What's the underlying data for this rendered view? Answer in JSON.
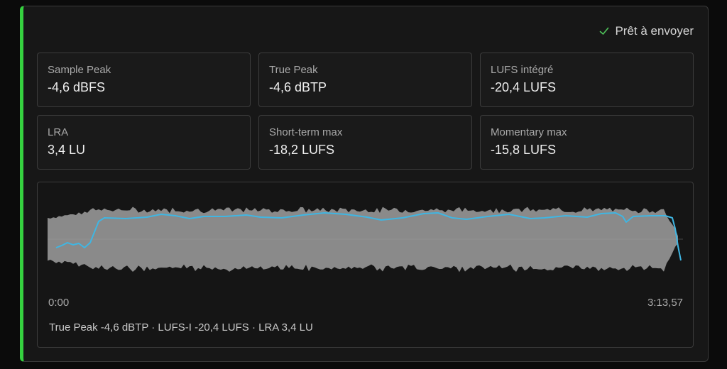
{
  "status": {
    "text": "Prêt à envoyer",
    "icon": "check-icon",
    "color": "#35d13f"
  },
  "metrics": [
    {
      "label": "Sample Peak",
      "value": "-4,6 dBFS"
    },
    {
      "label": "True Peak",
      "value": "-4,6 dBTP"
    },
    {
      "label": "LUFS intégré",
      "value": "-20,4 LUFS"
    },
    {
      "label": "LRA",
      "value": "3,4 LU"
    },
    {
      "label": "Short-term max",
      "value": "-18,2 LUFS"
    },
    {
      "label": "Momentary max",
      "value": "-15,8 LUFS"
    }
  ],
  "waveform": {
    "start_time": "0:00",
    "end_time": "3:13,57",
    "summary": "True Peak -4,6 dBTP · LUFS-I -20,4 LUFS · LRA 3,4 LU",
    "colors": {
      "accent": "#35d13f",
      "envelope": "#8a8a8a",
      "loudness": "#3fb6e3"
    }
  }
}
